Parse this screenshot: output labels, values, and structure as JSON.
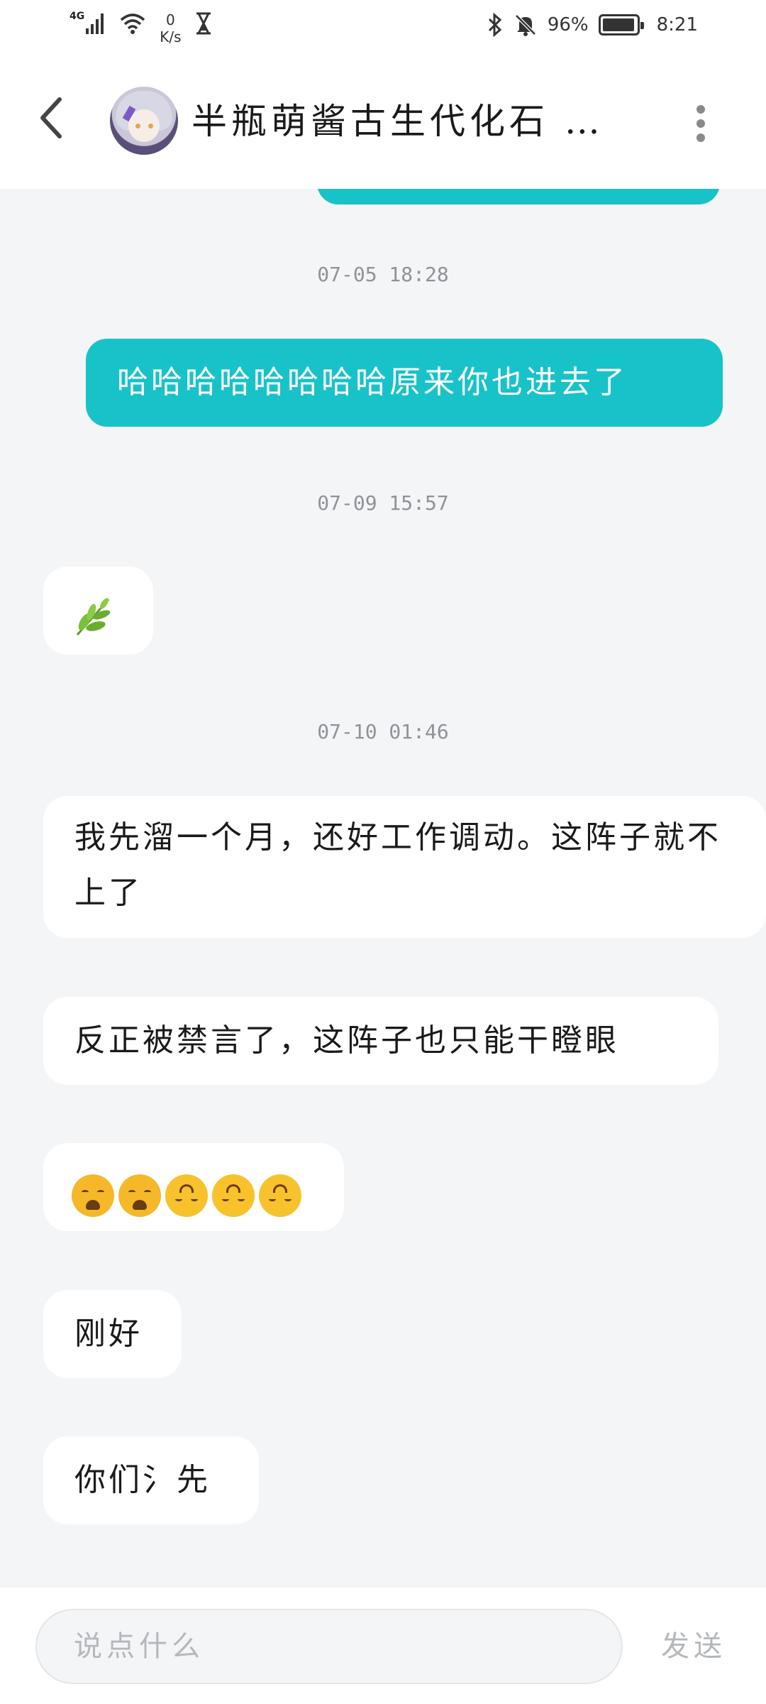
{
  "status_bar": {
    "network": "4G",
    "speed_value": "0",
    "speed_unit": "K/s",
    "battery_percent": "96%",
    "battery_level": 0.96,
    "time": "8:21"
  },
  "header": {
    "title": "半瓶萌酱古生代化石 …"
  },
  "messages": {
    "ts1": "07-05 18:28",
    "out1": "哈哈哈哈哈哈哈哈原来你也进去了",
    "ts2": "07-09 15:57",
    "ts3": "07-10 01:46",
    "in2": "我先溜一个月，还好工作调动。这阵子就不上了",
    "in3": "反正被禁言了，这阵子也只能干瞪眼",
    "in5": "刚好",
    "in6": "你们氵先"
  },
  "input": {
    "placeholder": "说点什么",
    "send_label": "发送"
  },
  "colors": {
    "accent": "#18c2c9",
    "background": "#f4f5f7"
  },
  "icons": [
    "back-arrow-icon",
    "more-vertical-icon",
    "herb-emoji",
    "weary-face-emoji",
    "upside-down-face-emoji",
    "bluetooth-icon",
    "bell-off-icon",
    "wifi-icon",
    "signal-icon",
    "hourglass-icon",
    "battery-icon"
  ]
}
